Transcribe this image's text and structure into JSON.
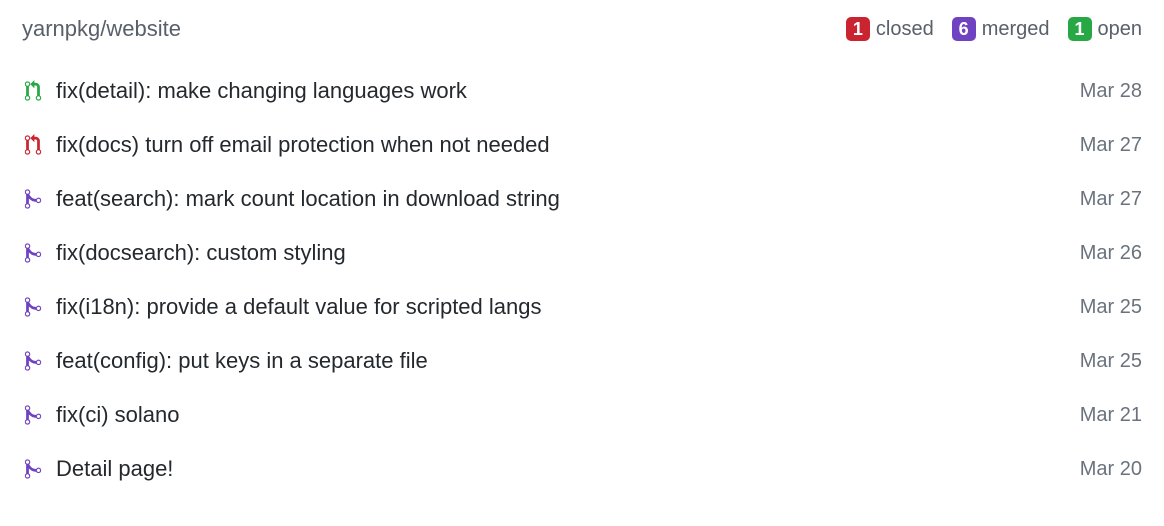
{
  "header": {
    "repo": "yarnpkg/website",
    "status": {
      "closed": {
        "count": "1",
        "label": "closed"
      },
      "merged": {
        "count": "6",
        "label": "merged"
      },
      "open": {
        "count": "1",
        "label": "open"
      }
    }
  },
  "pull_requests": [
    {
      "status": "open",
      "title": "fix(detail): make changing languages work",
      "date": "Mar 28"
    },
    {
      "status": "closed",
      "title": "fix(docs) turn off email protection when not needed",
      "date": "Mar 27"
    },
    {
      "status": "merged",
      "title": "feat(search): mark count location in download string",
      "date": "Mar 27"
    },
    {
      "status": "merged",
      "title": "fix(docsearch): custom styling",
      "date": "Mar 26"
    },
    {
      "status": "merged",
      "title": "fix(i18n): provide a default value for scripted langs",
      "date": "Mar 25"
    },
    {
      "status": "merged",
      "title": "feat(config): put keys in a separate file",
      "date": "Mar 25"
    },
    {
      "status": "merged",
      "title": "fix(ci) solano",
      "date": "Mar 21"
    },
    {
      "status": "merged",
      "title": "Detail page!",
      "date": "Mar 20"
    }
  ]
}
